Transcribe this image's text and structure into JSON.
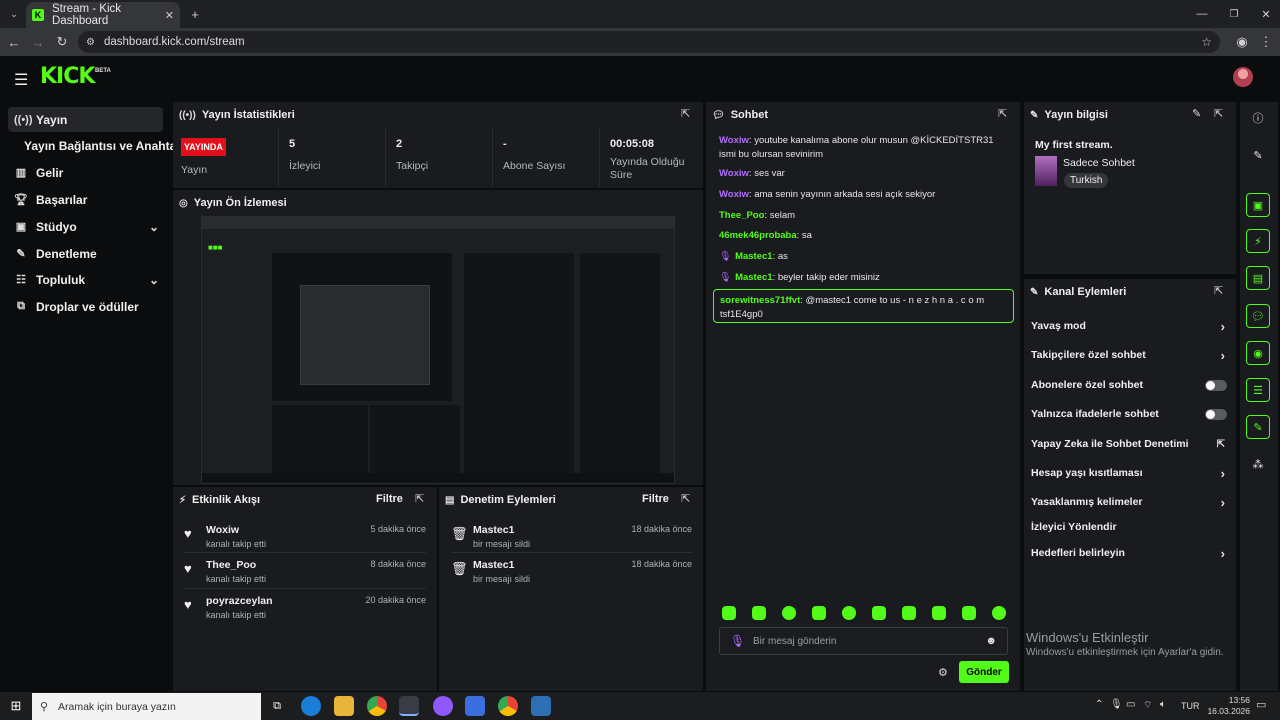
{
  "browser": {
    "tab_title": "Stream - Kick Dashboard",
    "url": "dashboard.kick.com/stream"
  },
  "app": {
    "logo": "KICK",
    "beta": "BETA"
  },
  "sidebar": {
    "items": [
      {
        "label": "Yayın",
        "icon": "broadcast-icon"
      },
      {
        "label": "Yayın Bağlantısı ve Anahtarı"
      },
      {
        "label": "Gelir",
        "icon": "chart-icon"
      },
      {
        "label": "Başarılar",
        "icon": "trophy-icon"
      },
      {
        "label": "Stüdyo",
        "icon": "studio-icon"
      },
      {
        "label": "Denetleme",
        "icon": "wrench-icon"
      },
      {
        "label": "Topluluk",
        "icon": "community-icon"
      },
      {
        "label": "Droplar ve ödüller",
        "icon": "drops-icon"
      }
    ]
  },
  "stats": {
    "title": "Yayın İstatistikleri",
    "live_badge": "YAYINDA",
    "live_label": "Yayın",
    "items": [
      {
        "value": "5",
        "label": "İzleyici"
      },
      {
        "value": "2",
        "label": "Takipçi"
      },
      {
        "value": "-",
        "label": "Abone Sayısı"
      },
      {
        "value": "00:05:08",
        "label": "Yayında Olduğu Süre"
      }
    ]
  },
  "preview": {
    "title": "Yayın Ön İzlemesi"
  },
  "activity": {
    "title": "Etkinlik Akışı",
    "filter": "Filtre",
    "items": [
      {
        "name": "Woxiw",
        "sub": "kanalı takip etti",
        "time": "5 dakika önce"
      },
      {
        "name": "Thee_Poo",
        "sub": "kanalı takip etti",
        "time": "8 dakika önce"
      },
      {
        "name": "poyrazceylan",
        "sub": "kanalı takip etti",
        "time": "20 dakika önce"
      }
    ]
  },
  "moderation": {
    "title": "Denetim Eylemleri",
    "filter": "Filtre",
    "items": [
      {
        "name": "Mastec1",
        "sub": "bir mesajı sildi",
        "time": "18 dakika önce"
      },
      {
        "name": "Mastec1",
        "sub": "bir mesajı sildi",
        "time": "18 dakika önce"
      }
    ]
  },
  "chat": {
    "title": "Sohbet",
    "messages": [
      {
        "user": "Woxiw",
        "text": "youtube kanalıma abone olur musun @KİCKEDİTSTR31 ismi bu olursan sevinirim",
        "color": "#b36bff"
      },
      {
        "user": "Woxiw",
        "text": "ses var",
        "color": "#b36bff"
      },
      {
        "user": "Woxiw",
        "text": "ama senin yayının arkada sesi açık sekiyor",
        "color": "#b36bff"
      },
      {
        "user": "Thee_Poo",
        "text": "selam",
        "color": "#53fc18"
      },
      {
        "user": "46mek46probaba",
        "text": "sa",
        "color": "#53fc18"
      },
      {
        "user": "Mastec1",
        "text": "as",
        "color": "#53fc18"
      },
      {
        "user": "Mastec1",
        "text": "beyler takip eder misiniz",
        "color": "#53fc18"
      }
    ],
    "highlight": {
      "user": "sorewitness71ffvt",
      "text": "@mastec1 come to us - n e z h n a . c o m tsf1E4gp0",
      "color": "#53fc18"
    },
    "input_placeholder": "Bir mesaj gönderin",
    "send": "Gönder"
  },
  "stream_info": {
    "title": "Yayın bilgisi",
    "stream_title": "My first stream.",
    "category": "Sadece Sohbet",
    "language": "Turkish"
  },
  "channel_actions": {
    "title": "Kanal Eylemleri",
    "items": [
      {
        "label": "Yavaş mod",
        "control": "chevron"
      },
      {
        "label": "Takipçilere özel sohbet",
        "control": "chevron"
      },
      {
        "label": "Abonelere özel sohbet",
        "control": "toggle"
      },
      {
        "label": "Yalnızca ifadelerle sohbet",
        "control": "toggle"
      },
      {
        "label": "Yapay Zeka ile Sohbet Denetimi",
        "control": "external"
      },
      {
        "label": "Hesap yaşı kısıtlaması",
        "control": "chevron"
      },
      {
        "label": "Yasaklanmış kelimeler",
        "control": "chevron"
      },
      {
        "label": "İzleyici Yönlendir",
        "control": "none"
      },
      {
        "label": "Hedefleri belirleyin",
        "control": "chevron"
      }
    ]
  },
  "watermark": {
    "line1": "Windows'u Etkinleştir",
    "line2": "Windows'u etkinleştirmek için Ayarlar'a gidin."
  },
  "taskbar": {
    "search_placeholder": "Aramak için buraya yazın",
    "lang": "TUR",
    "time": "13:56",
    "date": "16.03.2026"
  },
  "colors": {
    "accent": "#53fc18",
    "live": "#e1101b",
    "panel": "#191b1f"
  }
}
